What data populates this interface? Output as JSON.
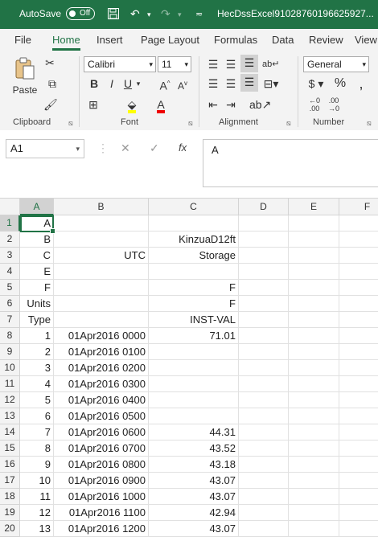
{
  "titlebar": {
    "autosave_label": "AutoSave",
    "autosave_state": "Off",
    "filename": "HecDssExcel91028760196625927..."
  },
  "tabs": [
    "File",
    "Home",
    "Insert",
    "Page Layout",
    "Formulas",
    "Data",
    "Review",
    "View"
  ],
  "active_tab": "Home",
  "ribbon": {
    "paste_label": "Paste",
    "font_name": "Calibri",
    "font_size": "11",
    "number_format": "General",
    "groups": [
      "Clipboard",
      "Font",
      "Alignment",
      "Number"
    ]
  },
  "formula_bar": {
    "name_box": "A1",
    "content": "A"
  },
  "columns": [
    "A",
    "B",
    "C",
    "D",
    "E",
    "F"
  ],
  "rows": [
    {
      "n": "1",
      "a": "A",
      "b": "",
      "c": ""
    },
    {
      "n": "2",
      "a": "B",
      "b": "",
      "c": "KinzuaD12ft"
    },
    {
      "n": "3",
      "a": "C",
      "b": "UTC",
      "c": "Storage"
    },
    {
      "n": "4",
      "a": "E",
      "b": "",
      "c": ""
    },
    {
      "n": "5",
      "a": "F",
      "b": "",
      "c": "F"
    },
    {
      "n": "6",
      "a": "Units",
      "b": "",
      "c": "F"
    },
    {
      "n": "7",
      "a": "Type",
      "b": "",
      "c": "INST-VAL"
    },
    {
      "n": "8",
      "a": "1",
      "b": "01Apr2016  0000",
      "c": "71.01"
    },
    {
      "n": "9",
      "a": "2",
      "b": "01Apr2016  0100",
      "c": ""
    },
    {
      "n": "10",
      "a": "3",
      "b": "01Apr2016  0200",
      "c": ""
    },
    {
      "n": "11",
      "a": "4",
      "b": "01Apr2016  0300",
      "c": ""
    },
    {
      "n": "12",
      "a": "5",
      "b": "01Apr2016  0400",
      "c": ""
    },
    {
      "n": "13",
      "a": "6",
      "b": "01Apr2016  0500",
      "c": ""
    },
    {
      "n": "14",
      "a": "7",
      "b": "01Apr2016  0600",
      "c": "44.31"
    },
    {
      "n": "15",
      "a": "8",
      "b": "01Apr2016  0700",
      "c": "43.52"
    },
    {
      "n": "16",
      "a": "9",
      "b": "01Apr2016  0800",
      "c": "43.18"
    },
    {
      "n": "17",
      "a": "10",
      "b": "01Apr2016  0900",
      "c": "43.07"
    },
    {
      "n": "18",
      "a": "11",
      "b": "01Apr2016  1000",
      "c": "43.07"
    },
    {
      "n": "19",
      "a": "12",
      "b": "01Apr2016  1100",
      "c": "42.94"
    },
    {
      "n": "20",
      "a": "13",
      "b": "01Apr2016  1200",
      "c": "43.07"
    }
  ],
  "colors": {
    "accent": "#217346"
  }
}
